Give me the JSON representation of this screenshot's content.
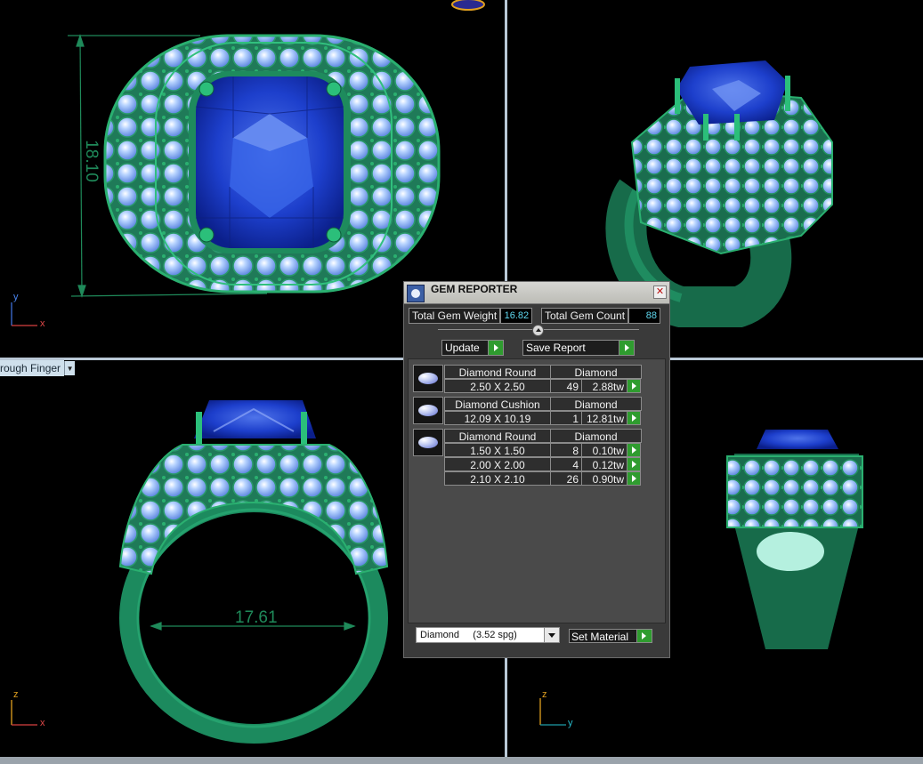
{
  "viewports": {
    "top": {
      "dimension": "18.10",
      "axes": [
        "y",
        "x"
      ]
    },
    "front": {
      "dimension": "17.61",
      "axes": [
        "z",
        "x"
      ]
    },
    "side": {
      "axes": [
        "z",
        "y"
      ]
    },
    "view_dropdown": "rough Finger"
  },
  "colors": {
    "metal": "#1d7a55",
    "sapphire": "#1f3fc4",
    "diamond": "#9ec4ff",
    "accent_play": "#2f9c2f",
    "value_text": "#5fd8f0"
  },
  "gem_reporter": {
    "title": "GEM REPORTER",
    "close_icon": "close-icon",
    "total_weight_label": "Total Gem Weight",
    "total_weight_value": "16.82",
    "total_count_label": "Total Gem Count",
    "total_count_value": "88",
    "update_label": "Update",
    "save_report_label": "Save Report",
    "groups": [
      {
        "name": "Diamond Round",
        "material": "Diamond",
        "rows": [
          {
            "size": "2.50 X 2.50",
            "count": "49",
            "weight": "2.88tw"
          }
        ]
      },
      {
        "name": "Diamond Cushion",
        "material": "Diamond",
        "rows": [
          {
            "size": "12.09 X 10.19",
            "count": "1",
            "weight": "12.81tw"
          }
        ]
      },
      {
        "name": "Diamond Round",
        "material": "Diamond",
        "rows": [
          {
            "size": "1.50 X 1.50",
            "count": "8",
            "weight": "0.10tw"
          },
          {
            "size": "2.00 X 2.00",
            "count": "4",
            "weight": "0.12tw"
          },
          {
            "size": "2.10 X 2.10",
            "count": "26",
            "weight": "0.90tw"
          }
        ]
      }
    ],
    "material_select": "Diamond     (3.52 spg)",
    "set_material_label": "Set Material"
  }
}
